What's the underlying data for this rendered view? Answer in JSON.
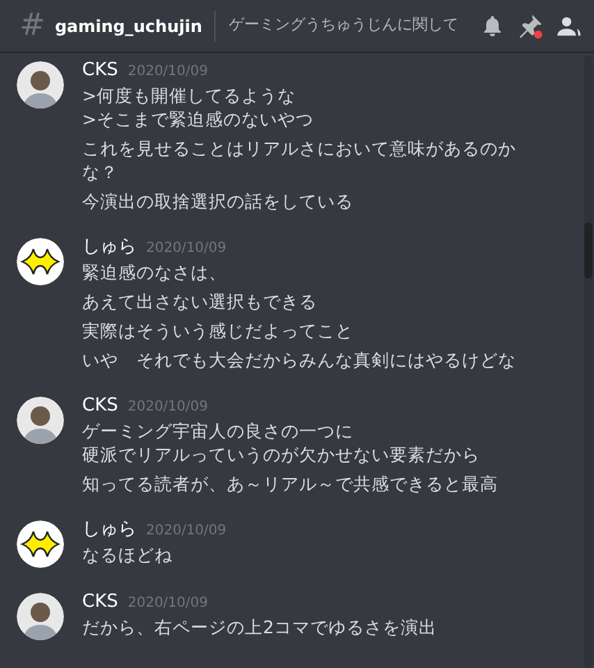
{
  "header": {
    "hash": "#",
    "channel": "gaming_uchujin",
    "topic": "ゲーミングうちゅうじんに関して"
  },
  "groups": [
    {
      "author": "CKS",
      "date": "2020/10/09",
      "avatar": {
        "kind": "photo"
      },
      "messages": [
        {
          "lines": [
            ">何度も開催してるような",
            ">そこまで緊迫感のないやつ"
          ]
        },
        {
          "lines": [
            "これを見せることはリアルさにおいて意味があるのかな？"
          ]
        },
        {
          "lines": [
            "今演出の取捨選択の話をしている"
          ]
        }
      ]
    },
    {
      "author": "しゅら",
      "date": "2020/10/09",
      "avatar": {
        "kind": "sparkle"
      },
      "messages": [
        {
          "lines": [
            "緊迫感のなさは、"
          ]
        },
        {
          "lines": [
            "あえて出さない選択もできる"
          ]
        },
        {
          "lines": [
            "実際はそういう感じだよってこと"
          ]
        },
        {
          "lines": [
            "いや　それでも大会だからみんな真剣にはやるけどな"
          ]
        }
      ]
    },
    {
      "author": "CKS",
      "date": "2020/10/09",
      "avatar": {
        "kind": "photo"
      },
      "messages": [
        {
          "lines": [
            "ゲーミング宇宙人の良さの一つに",
            "硬派でリアルっていうのが欠かせない要素だから"
          ]
        },
        {
          "lines": [
            "知ってる読者が、あ～リアル～で共感できると最高"
          ]
        }
      ]
    },
    {
      "author": "しゅら",
      "date": "2020/10/09",
      "avatar": {
        "kind": "sparkle"
      },
      "messages": [
        {
          "lines": [
            "なるほどね"
          ]
        }
      ]
    },
    {
      "author": "CKS",
      "date": "2020/10/09",
      "avatar": {
        "kind": "photo"
      },
      "messages": [
        {
          "lines": [
            "だから、右ページの上2コマでゆるさを演出"
          ]
        }
      ]
    }
  ]
}
